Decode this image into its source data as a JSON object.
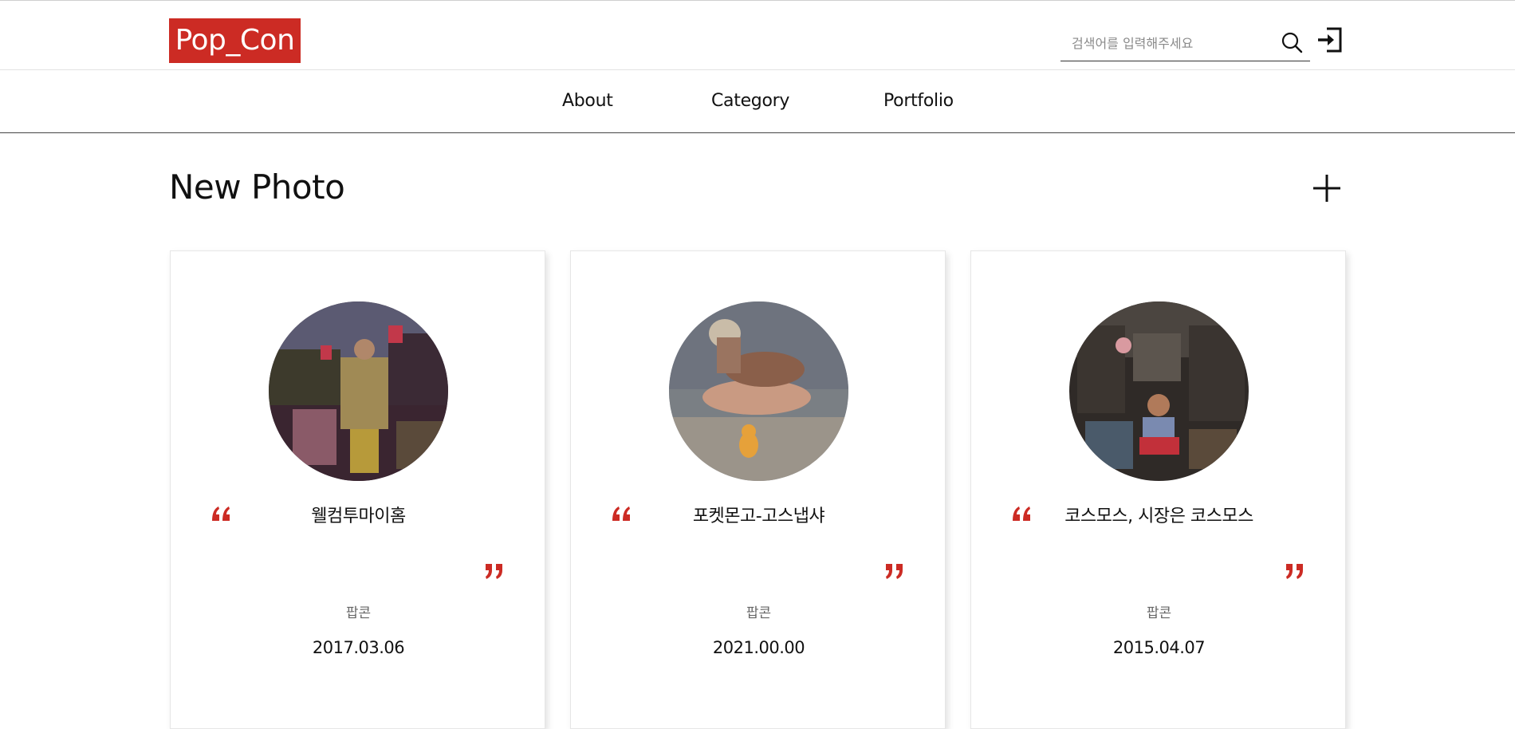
{
  "header": {
    "logo_text": "Pop_Con",
    "search_placeholder": "검색어를 입력해주세요",
    "search_value": "",
    "icons": [
      "search-icon",
      "login-icon"
    ],
    "logo_color": "#cc2b24"
  },
  "nav": {
    "items": [
      {
        "label": "About"
      },
      {
        "label": "Category"
      },
      {
        "label": "Portfolio"
      }
    ]
  },
  "section": {
    "title": "New Photo",
    "more_icon": "plus-icon"
  },
  "cards": [
    {
      "title": "웰컴투마이홈",
      "category": "팝콘",
      "date": "2017.03.06"
    },
    {
      "title": "포켓몬고-고스냅샤",
      "category": "팝콘",
      "date": "2021.00.00"
    },
    {
      "title": "코스모스, 시장은 코스모스",
      "category": "팝콘",
      "date": "2015.04.07"
    }
  ],
  "accent_color": "#cc2b24"
}
